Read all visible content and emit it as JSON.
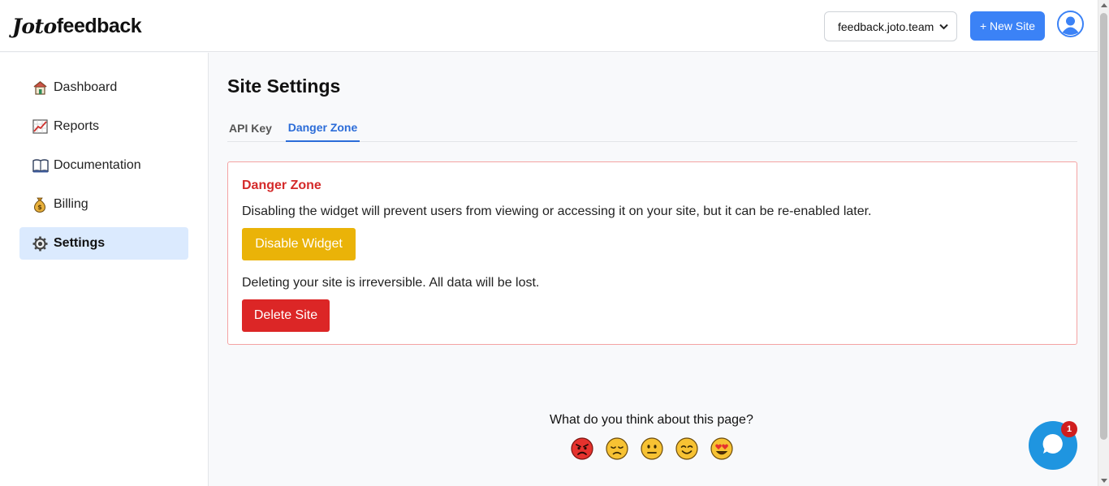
{
  "header": {
    "logo_script": "Joto",
    "logo_bold": "feedback",
    "site_select_value": "feedback.joto.team",
    "new_site_label": "+ New Site"
  },
  "sidebar": {
    "items": [
      {
        "label": "Dashboard",
        "icon": "house-icon"
      },
      {
        "label": "Reports",
        "icon": "chart-icon"
      },
      {
        "label": "Documentation",
        "icon": "book-icon"
      },
      {
        "label": "Billing",
        "icon": "money-bag-icon"
      },
      {
        "label": "Settings",
        "icon": "gear-icon",
        "active": true
      }
    ]
  },
  "main": {
    "title": "Site Settings",
    "tabs": [
      {
        "label": "API Key"
      },
      {
        "label": "Danger Zone",
        "active": true
      }
    ],
    "danger": {
      "title": "Danger Zone",
      "disable_text": "Disabling the widget will prevent users from viewing or accessing it on your site, but it can be re-enabled later.",
      "disable_button": "Disable Widget",
      "delete_text": "Deleting your site is irreversible. All data will be lost.",
      "delete_button": "Delete Site"
    }
  },
  "feedback": {
    "question": "What do you think about this page?",
    "emojis": [
      "angry-face-icon",
      "sad-face-icon",
      "neutral-face-icon",
      "smile-face-icon",
      "heart-eyes-face-icon"
    ]
  },
  "chat": {
    "badge_count": "1"
  },
  "colors": {
    "accent": "#3b82f6",
    "active_nav_bg": "#dbeafe",
    "danger": "#dc2626",
    "warning": "#eab308",
    "chat": "#1f95e0"
  }
}
